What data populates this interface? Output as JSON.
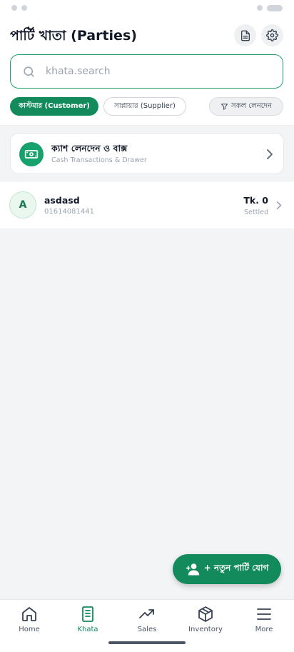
{
  "header": {
    "title": "পার্টি খাতা (Parties)",
    "doc_icon": "document-icon",
    "settings_icon": "gear-icon"
  },
  "search": {
    "placeholder": "khata.search",
    "value": ""
  },
  "filters": {
    "customer": "কাস্টমার (Customer)",
    "supplier": "সাপ্লায়ার (Supplier)",
    "all_transactions": "সকল লেনদেন"
  },
  "cash_card": {
    "title": "ক্যাশ লেনদেন ও বাক্স",
    "subtitle": "Cash Transactions & Drawer"
  },
  "parties": [
    {
      "initial": "A",
      "name": "asdasd",
      "phone": "01614081441",
      "amount": "Tk. 0",
      "status": "Settled"
    }
  ],
  "fab": {
    "label": "+ নতুন পার্টি যোগ"
  },
  "nav": {
    "items": [
      {
        "label": "Home",
        "icon": "home-icon"
      },
      {
        "label": "Khata",
        "icon": "book-icon"
      },
      {
        "label": "Sales",
        "icon": "trend-icon"
      },
      {
        "label": "Inventory",
        "icon": "box-icon"
      },
      {
        "label": "More",
        "icon": "menu-icon"
      }
    ],
    "active": "Khata"
  },
  "colors": {
    "brand": "#128a5b",
    "brand_light": "#17a26d",
    "border_accent": "#22a06b"
  }
}
